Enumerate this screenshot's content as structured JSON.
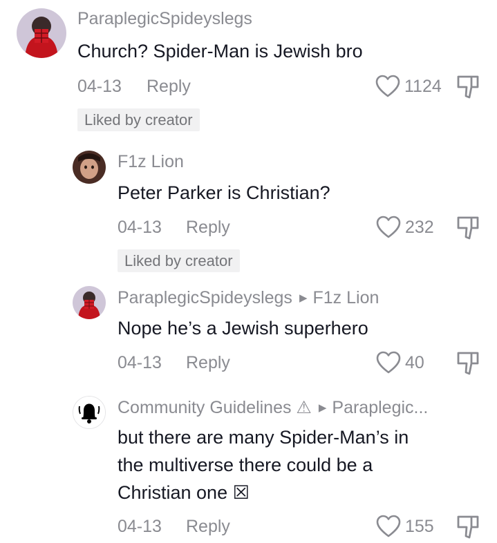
{
  "comments": [
    {
      "username": "ParaplegicSpideyslegs",
      "reply_to": "",
      "text": "Church? Spider-Man is Jewish bro",
      "date": "04-13",
      "reply_label": "Reply",
      "likes": "1124",
      "badge": "Liked by creator"
    },
    {
      "username": "F1z Lion",
      "reply_to": "",
      "text": "Peter Parker is Christian?",
      "date": "04-13",
      "reply_label": "Reply",
      "likes": "232",
      "badge": "Liked by creator"
    },
    {
      "username": "ParaplegicSpideyslegs",
      "reply_to": "F1z Lion",
      "text": "Nope he’s a Jewish superhero",
      "date": "04-13",
      "reply_label": "Reply",
      "likes": "40",
      "badge": ""
    },
    {
      "username": "Community Guidelines ⚠",
      "reply_to": "Paraplegic...",
      "text_lines": [
        "but there are many Spider-Man’s in",
        "the multiverse there could be a",
        "Christian one ☒"
      ],
      "date": "04-13",
      "reply_label": "Reply",
      "likes": "155",
      "badge": ""
    }
  ]
}
